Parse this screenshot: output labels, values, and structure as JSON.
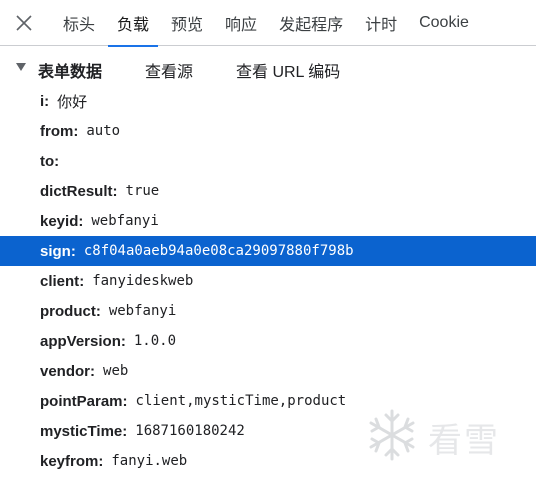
{
  "tabs": [
    {
      "label": "标头",
      "active": false
    },
    {
      "label": "负载",
      "active": true
    },
    {
      "label": "预览",
      "active": false
    },
    {
      "label": "响应",
      "active": false
    },
    {
      "label": "发起程序",
      "active": false
    },
    {
      "label": "计时",
      "active": false
    },
    {
      "label": "Cookie",
      "active": false
    }
  ],
  "section": {
    "title": "表单数据",
    "view_source": "查看源",
    "view_url_encoded": "查看 URL 编码"
  },
  "fields": [
    {
      "key": "i",
      "value": "你好"
    },
    {
      "key": "from",
      "value": "auto"
    },
    {
      "key": "to",
      "value": ""
    },
    {
      "key": "dictResult",
      "value": "true"
    },
    {
      "key": "keyid",
      "value": "webfanyi"
    },
    {
      "key": "sign",
      "value": "c8f04a0aeb94a0e08ca29097880f798b"
    },
    {
      "key": "client",
      "value": "fanyideskweb"
    },
    {
      "key": "product",
      "value": "webfanyi"
    },
    {
      "key": "appVersion",
      "value": "1.0.0"
    },
    {
      "key": "vendor",
      "value": "web"
    },
    {
      "key": "pointParam",
      "value": "client,mysticTime,product"
    },
    {
      "key": "mysticTime",
      "value": "1687160180242"
    },
    {
      "key": "keyfrom",
      "value": "fanyi.web"
    }
  ],
  "selected_field": "sign",
  "watermark": {
    "text": "看雪",
    "icon": "snowflake-icon"
  },
  "colors": {
    "accent": "#1a73e8",
    "selected_row": "#0b63cf",
    "border": "#cbcdd1"
  }
}
